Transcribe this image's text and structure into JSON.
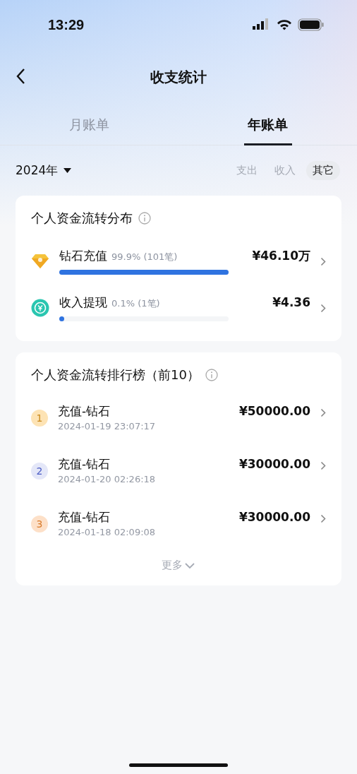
{
  "status_bar": {
    "time": "13:29"
  },
  "nav": {
    "title": "收支统计"
  },
  "tabs": [
    {
      "label": "月账单",
      "selected": false
    },
    {
      "label": "年账单",
      "selected": true
    }
  ],
  "year_picker": {
    "label": "2024年"
  },
  "filters": [
    {
      "label": "支出",
      "selected": false
    },
    {
      "label": "收入",
      "selected": false
    },
    {
      "label": "其它",
      "selected": true
    }
  ],
  "distribution": {
    "title": "个人资金流转分布",
    "items": [
      {
        "kind": "diamond",
        "name": "钻石充值",
        "share": "99.9% (101笔)",
        "amount": "¥46.10万",
        "level": 0.999
      },
      {
        "kind": "withdraw",
        "name": "收入提现",
        "share": "0.1% (1笔)",
        "amount": "¥4.36",
        "level": 0.01
      }
    ]
  },
  "ranking": {
    "title": "个人资金流转排行榜（前10）",
    "items": [
      {
        "rank": "1",
        "color": "#fde3b4",
        "name": "充值-钻石",
        "time": "2024-01-19 23:07:17",
        "amount": "¥50000.00"
      },
      {
        "rank": "2",
        "color": "#e4e7f8",
        "name": "充值-钻石",
        "time": "2024-01-20 02:26:18",
        "amount": "¥30000.00"
      },
      {
        "rank": "3",
        "color": "#fde0c8",
        "name": "充值-钻石",
        "time": "2024-01-18 02:09:08",
        "amount": "¥30000.00"
      }
    ],
    "more": "更多"
  }
}
